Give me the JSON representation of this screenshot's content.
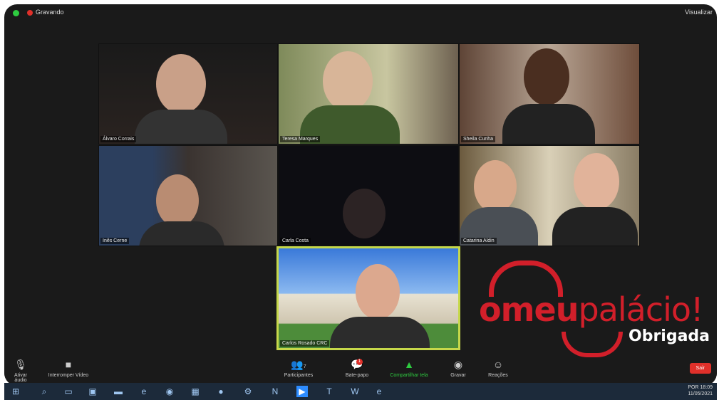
{
  "window": {
    "recording_label": "Gravando",
    "view_label": "Visualizar"
  },
  "participants": [
    {
      "name": "Álvaro Corrais"
    },
    {
      "name": "Teresa Marques"
    },
    {
      "name": "Sheila Cunha"
    },
    {
      "name": "Inês Cerne"
    },
    {
      "name": "Carla Costa"
    },
    {
      "name": "Catarina Aldin"
    },
    {
      "name": "Carlos Rosado CRC"
    }
  ],
  "brand": {
    "o": "o",
    "meu": "meu",
    "palacio": "palácio!",
    "thanks": "Obrigada"
  },
  "toolbar": {
    "audio": "Ativar áudio",
    "video": "Interromper Vídeo",
    "participants": "Participantes",
    "participants_count": "7",
    "chat": "Bate-papo",
    "chat_badge": "1",
    "share": "Compartilhar tela",
    "record": "Gravar",
    "reactions": "Reações",
    "leave": "Sair"
  },
  "taskbar": {
    "icons": [
      "windows-icon",
      "search-icon",
      "task-view-icon",
      "store-icon",
      "files-icon",
      "edge-icon",
      "chrome-icon",
      "photos-icon",
      "firefox-icon",
      "settings-icon",
      "onenote-icon",
      "zoom-icon",
      "teams-icon",
      "word-icon",
      "ie-icon"
    ],
    "time": "18:09",
    "date": "11/05/2021",
    "lang": "POR"
  },
  "colors": {
    "brand_red": "#d21f2a",
    "active_border": "#c6d84a",
    "share_green": "#2ecc40"
  }
}
